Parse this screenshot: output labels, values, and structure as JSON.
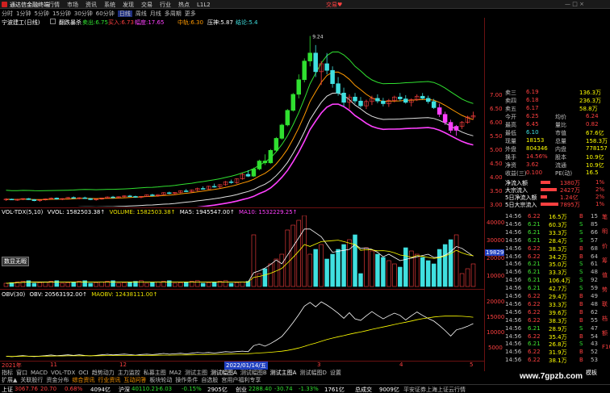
{
  "title_bar": {
    "app_name": "通达信金融终端",
    "menu": [
      "行情",
      "市场",
      "资讯",
      "系统",
      "发现",
      "交易",
      "行业",
      "热点",
      "L1L2"
    ],
    "right_label": "交易♥"
  },
  "period_bar": {
    "items": [
      "分时",
      "1分钟",
      "5分钟",
      "15分钟",
      "30分钟",
      "60分钟",
      "日线",
      "周线",
      "月线",
      "多周期",
      "更多"
    ],
    "active": "日线"
  },
  "stock_header": {
    "name": "宁波建工(日线)",
    "indicator": "翻跌暴杀",
    "sell_label": "卖出:6.75",
    "buy_label": "买入:6.73",
    "range_label": "幅度:17.65",
    "mid_label": "中轨:6.30",
    "press_label": "压神:5.87",
    "extra_label": "结论:5.4"
  },
  "main_chart": {
    "peak_label": "9.24",
    "y_labels": [
      "7.00",
      "6.50",
      "6.00",
      "5.50",
      "5.00",
      "4.50",
      "4.00",
      "3.50",
      "3.00"
    ],
    "candles": [
      [
        3.1,
        3.15,
        3.05,
        3.12
      ],
      [
        3.12,
        3.14,
        3.08,
        3.1
      ],
      [
        3.1,
        3.13,
        3.06,
        3.11
      ],
      [
        3.11,
        3.15,
        3.08,
        3.14
      ],
      [
        3.14,
        3.16,
        3.09,
        3.1
      ],
      [
        3.1,
        3.12,
        3.04,
        3.06
      ],
      [
        3.06,
        3.1,
        3.02,
        3.09
      ],
      [
        3.09,
        3.14,
        3.07,
        3.13
      ],
      [
        3.13,
        3.18,
        3.11,
        3.16
      ],
      [
        3.16,
        3.18,
        3.1,
        3.12
      ],
      [
        3.12,
        3.15,
        3.08,
        3.14
      ],
      [
        3.14,
        3.2,
        3.12,
        3.18
      ],
      [
        3.18,
        3.22,
        3.14,
        3.15
      ],
      [
        3.15,
        3.19,
        3.11,
        3.17
      ],
      [
        3.17,
        3.21,
        3.13,
        3.14
      ],
      [
        3.14,
        3.16,
        3.08,
        3.1
      ],
      [
        3.1,
        3.13,
        3.06,
        3.12
      ],
      [
        3.12,
        3.17,
        3.1,
        3.16
      ],
      [
        3.16,
        3.22,
        3.14,
        3.2
      ],
      [
        3.2,
        3.24,
        3.16,
        3.18
      ],
      [
        3.18,
        3.22,
        3.14,
        3.21
      ],
      [
        3.21,
        3.26,
        3.18,
        3.24
      ],
      [
        3.24,
        3.28,
        3.2,
        3.22
      ],
      [
        3.22,
        3.25,
        3.17,
        3.19
      ],
      [
        3.19,
        3.23,
        3.15,
        3.22
      ],
      [
        3.22,
        3.3,
        3.2,
        3.28
      ],
      [
        3.28,
        3.32,
        3.22,
        3.25
      ],
      [
        3.25,
        3.3,
        3.21,
        3.29
      ],
      [
        3.29,
        3.38,
        3.27,
        3.36
      ],
      [
        3.36,
        3.4,
        3.3,
        3.33
      ],
      [
        3.33,
        3.38,
        3.28,
        3.37
      ],
      [
        3.37,
        3.45,
        3.34,
        3.43
      ],
      [
        3.43,
        3.5,
        3.38,
        3.4
      ],
      [
        3.4,
        3.48,
        3.36,
        3.46
      ],
      [
        3.46,
        3.55,
        3.42,
        3.52
      ],
      [
        3.52,
        3.6,
        3.48,
        3.5
      ],
      [
        3.5,
        3.62,
        3.47,
        3.6
      ],
      [
        3.6,
        3.7,
        3.55,
        3.58
      ],
      [
        3.58,
        3.68,
        3.52,
        3.66
      ],
      [
        3.66,
        3.8,
        3.62,
        3.77
      ],
      [
        3.77,
        3.85,
        3.7,
        3.74
      ],
      [
        3.74,
        3.9,
        3.7,
        3.88
      ],
      [
        3.88,
        4.1,
        3.85,
        4.05
      ],
      [
        4.05,
        4.2,
        3.95,
        3.98
      ],
      [
        3.98,
        4.3,
        3.95,
        4.25
      ],
      [
        4.25,
        4.6,
        4.2,
        4.55
      ],
      [
        4.55,
        4.8,
        4.4,
        4.48
      ],
      [
        4.48,
        5.0,
        4.45,
        4.95
      ],
      [
        4.95,
        5.45,
        4.9,
        5.4
      ],
      [
        5.4,
        5.95,
        5.35,
        5.9
      ],
      [
        5.9,
        6.5,
        5.85,
        6.45
      ],
      [
        6.45,
        7.1,
        6.4,
        7.05
      ],
      [
        7.05,
        7.8,
        6.9,
        7.6
      ],
      [
        7.6,
        8.4,
        7.5,
        8.3
      ],
      [
        8.3,
        9.24,
        8.1,
        8.6
      ],
      [
        8.6,
        8.9,
        7.7,
        7.9
      ],
      [
        7.9,
        8.3,
        7.4,
        8.2
      ],
      [
        8.2,
        8.6,
        7.8,
        7.95
      ],
      [
        7.95,
        8.1,
        7.3,
        7.45
      ],
      [
        7.45,
        7.7,
        7.0,
        7.1
      ],
      [
        7.1,
        7.3,
        6.6,
        6.75
      ],
      [
        6.75,
        7.05,
        6.5,
        6.95
      ],
      [
        6.95,
        7.1,
        6.7,
        6.8
      ],
      [
        6.8,
        6.95,
        6.55,
        6.62
      ],
      [
        6.62,
        6.85,
        6.5,
        6.78
      ],
      [
        6.78,
        7.0,
        6.65,
        6.9
      ],
      [
        6.9,
        7.05,
        6.72,
        6.8
      ],
      [
        6.8,
        6.92,
        6.6,
        6.7
      ],
      [
        6.7,
        6.88,
        6.58,
        6.82
      ],
      [
        6.82,
        7.0,
        6.75,
        6.95
      ],
      [
        6.95,
        7.1,
        6.8,
        6.88
      ],
      [
        6.88,
        7.02,
        6.7,
        6.75
      ],
      [
        6.75,
        6.9,
        6.6,
        6.85
      ],
      [
        6.85,
        7.05,
        6.8,
        6.98
      ],
      [
        6.98,
        7.1,
        6.85,
        6.9
      ],
      [
        6.9,
        7.0,
        6.7,
        6.78
      ],
      [
        6.78,
        6.88,
        6.5,
        6.55
      ],
      [
        6.55,
        6.7,
        6.2,
        6.3
      ],
      [
        6.3,
        6.4,
        5.9,
        6.0
      ],
      [
        6.0,
        6.1,
        5.6,
        5.7
      ],
      [
        5.7,
        5.9,
        5.5,
        5.85
      ],
      [
        5.85,
        6.05,
        5.75,
        6.0
      ],
      [
        6.0,
        6.25,
        5.95,
        6.2
      ],
      [
        6.2,
        6.4,
        6.1,
        6.25
      ]
    ]
  },
  "vol_header": {
    "name": "VOL-TDX(5,10)",
    "vvol": "VVOL: 1582503.38↑",
    "volume": "VOLUME: 1582503.38↑",
    "ma5": "MA5: 1945547.00↑",
    "ma10": "MA10: 1532229.25↑"
  },
  "vol_axis": [
    "40000",
    "30000",
    "20000",
    "10000"
  ],
  "vol_box": "19829",
  "vol_tag": "数显无暇",
  "obv_header": {
    "name": "OBV(30)",
    "obv": "OBV: 20563192.00↑",
    "maobv": "MAOBV: 12438111.00↑"
  },
  "obv_axis": [
    "20000",
    "15000",
    "10000",
    "5000"
  ],
  "date_axis": {
    "left": "2021年",
    "labels": [
      "11",
      "12"
    ],
    "highlight": "2022/01/14/五",
    "right": [
      "3",
      "4",
      "5"
    ]
  },
  "right_panel": {
    "y_top": [
      "7.00",
      "6.50",
      "6.00"
    ],
    "quote_rows": [
      {
        "label": "卖三",
        "price": "6.19",
        "vol": "136.3万"
      },
      {
        "label": "卖四",
        "price": "6.18",
        "vol": "236.3万"
      },
      {
        "label": "卖五",
        "price": "6.17",
        "vol": "58.8万"
      },
      {
        "label": "今开",
        "price": "6.25",
        "label2": "均价",
        "val2": "6.24"
      },
      {
        "label": "最高",
        "price": "6.45",
        "label2": "量比",
        "val2": "0.82"
      },
      {
        "label": "最低",
        "price": "6.10",
        "label2": "市值",
        "val2": "67.6亿"
      },
      {
        "label": "现量",
        "price": "18153",
        "label2": "总量",
        "val2": "158.3万"
      },
      {
        "label": "外盘",
        "price": "804346",
        "label2": "内盘",
        "val2": "778157"
      },
      {
        "label": "换手",
        "price": "14.56%",
        "label2": "股本",
        "val2": "10.9亿"
      },
      {
        "label": "净资",
        "price": "3.62",
        "label2": "流通",
        "val2": "10.9亿"
      },
      {
        "label": "收益(三)",
        "price": "0.100",
        "label2": "PE(动)",
        "val2": "16.5"
      }
    ],
    "flow_rows": [
      {
        "label": "净流入额",
        "val": "1380万",
        "pct": "1%"
      },
      {
        "label": "大宗流入",
        "val": "2427万",
        "pct": "2%"
      },
      {
        "label": "5日净流入额",
        "val": "1.24亿",
        "pct": "2%"
      },
      {
        "label": "5日大宗流入",
        "val": "7895万",
        "pct": "1%"
      }
    ],
    "ticks": [
      [
        "14:56",
        "6.22",
        "16.5万",
        "B",
        "15"
      ],
      [
        "14:56",
        "6.21",
        "60.3万",
        "S",
        "85"
      ],
      [
        "14:56",
        "6.21",
        "33.3万",
        "S",
        "66"
      ],
      [
        "14:56",
        "6.21",
        "28.4万",
        "S",
        "57"
      ],
      [
        "14:56",
        "6.22",
        "38.3万",
        "B",
        "68"
      ],
      [
        "14:56",
        "6.22",
        "34.2万",
        "B",
        "64"
      ],
      [
        "14:56",
        "6.21",
        "35.0万",
        "S",
        "61"
      ],
      [
        "14:56",
        "6.21",
        "33.3万",
        "S",
        "48"
      ],
      [
        "14:56",
        "6.21",
        "106.4万",
        "S",
        "92"
      ],
      [
        "14:56",
        "6.21",
        "42.7万",
        "S",
        "59"
      ],
      [
        "14:56",
        "6.22",
        "29.4万",
        "B",
        "49"
      ],
      [
        "14:56",
        "6.22",
        "33.3万",
        "B",
        "48"
      ],
      [
        "14:56",
        "6.22",
        "39.6万",
        "B",
        "62"
      ],
      [
        "14:56",
        "6.22",
        "38.3万",
        "B",
        "55"
      ],
      [
        "14:56",
        "6.21",
        "28.9万",
        "S",
        "47"
      ],
      [
        "14:56",
        "6.22",
        "35.4万",
        "B",
        "54"
      ],
      [
        "14:56",
        "6.21",
        "26.8万",
        "S",
        "43"
      ],
      [
        "14:56",
        "6.22",
        "31.9万",
        "B",
        "52"
      ],
      [
        "14:56",
        "6.22",
        "38.1万",
        "B",
        "53"
      ]
    ],
    "side_tabs": [
      "笔",
      "明",
      "价",
      "筹",
      "值",
      "势",
      "联",
      "档",
      "额",
      "F10"
    ],
    "bottom_tab": "模板"
  },
  "bottom_tabs_row1": [
    "指标",
    "窗口",
    "MACD",
    "VOL-TDX",
    "OCI",
    "趋势动力",
    "主力监控",
    "私募主图",
    "MA2",
    "测试主图",
    "测试幅图A",
    "测试幅图B",
    "测试主图A",
    "测试幅图D",
    "设置"
  ],
  "bottom_tabs_row2": [
    "扩展▲",
    "关联股行",
    "资金分布",
    "综合资讯",
    "行业资讯",
    "互动问答",
    "板块轮动",
    "操作条件",
    "自选股"
  ],
  "bottom_tabs_row2_tail": "宫用户福利专享",
  "status_bar": {
    "items": [
      {
        "label": "上证",
        "v1": "3067.76",
        "v2": "20.70",
        "v3": "0.68%",
        "v4": "4094亿"
      },
      {
        "label": "沪深",
        "v1": "40110.21",
        "v2": "-6.03",
        "v3": "-0.15%",
        "v4": "2905亿"
      },
      {
        "label": "创业",
        "v1": "2288.40",
        "v2": "-30.74",
        "v3": "-1.33%",
        "v4": "1761亿"
      }
    ],
    "total_label": "总成交",
    "total_val": "9009亿",
    "scroll_text": "平安证券上海上证云行情",
    "watermark": "www.7gpzb.com"
  }
}
